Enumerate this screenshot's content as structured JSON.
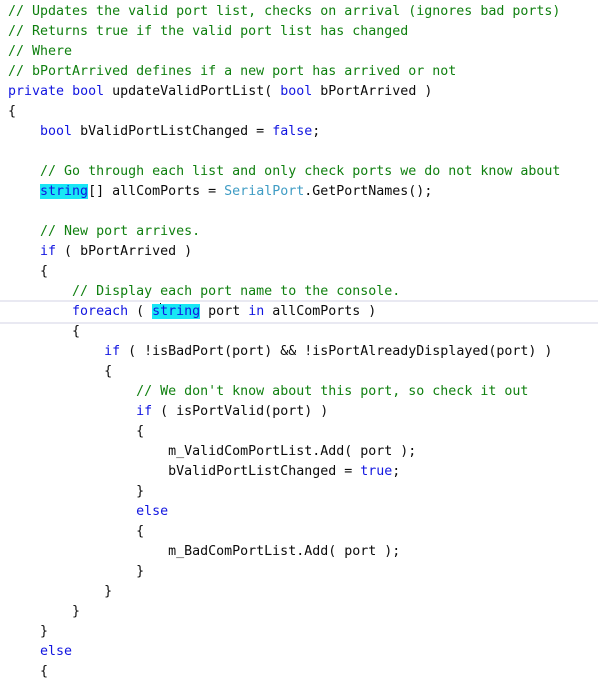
{
  "editor": {
    "name": "code-editor",
    "language": "C#",
    "background_color": "#ffffff",
    "font_size_px": 13.3,
    "line_height_px": 20,
    "tab_size": 4,
    "colors": {
      "comment": "#108010",
      "keyword": "#1216e0",
      "type": "#3f9cc4",
      "plain_text": "#0b0b0b",
      "selection_highlight": "#18e7f5",
      "current_line_rule": "#e9e9f2",
      "caret": "#000000"
    },
    "selection": {
      "selected_text": "string",
      "occurrences": 2,
      "caret_line_index": 15,
      "caret_after_characters": "s"
    }
  },
  "code": {
    "lines": [
      {
        "n": 1,
        "current": false,
        "tokens": [
          {
            "t": "cmt",
            "s": "// Updates the valid port list, checks on arrival (ignores bad ports)"
          }
        ]
      },
      {
        "n": 2,
        "current": false,
        "tokens": [
          {
            "t": "cmt",
            "s": "// Returns true if the valid port list has changed"
          }
        ]
      },
      {
        "n": 3,
        "current": false,
        "tokens": [
          {
            "t": "cmt",
            "s": "// Where"
          }
        ]
      },
      {
        "n": 4,
        "current": false,
        "tokens": [
          {
            "t": "cmt",
            "s": "// bPortArrived defines if a new port has arrived or not"
          }
        ]
      },
      {
        "n": 5,
        "current": false,
        "tokens": [
          {
            "t": "kw",
            "s": "private"
          },
          {
            "t": "plain",
            "s": " "
          },
          {
            "t": "kw",
            "s": "bool"
          },
          {
            "t": "plain",
            "s": " updateValidPortList( "
          },
          {
            "t": "kw",
            "s": "bool"
          },
          {
            "t": "plain",
            "s": " bPortArrived )"
          }
        ]
      },
      {
        "n": 6,
        "current": false,
        "tokens": [
          {
            "t": "plain",
            "s": "{"
          }
        ]
      },
      {
        "n": 7,
        "current": false,
        "tokens": [
          {
            "t": "plain",
            "s": "    "
          },
          {
            "t": "kw",
            "s": "bool"
          },
          {
            "t": "plain",
            "s": " bValidPortListChanged = "
          },
          {
            "t": "kw",
            "s": "false"
          },
          {
            "t": "plain",
            "s": ";"
          }
        ]
      },
      {
        "n": 8,
        "current": false,
        "tokens": [
          {
            "t": "plain",
            "s": ""
          }
        ]
      },
      {
        "n": 9,
        "current": false,
        "tokens": [
          {
            "t": "plain",
            "s": "    "
          },
          {
            "t": "cmt",
            "s": "// Go through each list and only check ports we do not know about"
          }
        ]
      },
      {
        "n": 10,
        "current": false,
        "tokens": [
          {
            "t": "plain",
            "s": "    "
          },
          {
            "t": "sel",
            "s": "string"
          },
          {
            "t": "plain",
            "s": "[] allComPorts = "
          },
          {
            "t": "typ",
            "s": "SerialPort"
          },
          {
            "t": "plain",
            "s": ".GetPortNames();"
          }
        ]
      },
      {
        "n": 11,
        "current": false,
        "tokens": [
          {
            "t": "plain",
            "s": ""
          }
        ]
      },
      {
        "n": 12,
        "current": false,
        "tokens": [
          {
            "t": "plain",
            "s": "    "
          },
          {
            "t": "cmt",
            "s": "// New port arrives."
          }
        ]
      },
      {
        "n": 13,
        "current": false,
        "tokens": [
          {
            "t": "plain",
            "s": "    "
          },
          {
            "t": "kw",
            "s": "if"
          },
          {
            "t": "plain",
            "s": " ( bPortArrived )"
          }
        ]
      },
      {
        "n": 14,
        "current": false,
        "tokens": [
          {
            "t": "plain",
            "s": "    {"
          }
        ]
      },
      {
        "n": 15,
        "current": false,
        "tokens": [
          {
            "t": "plain",
            "s": "        "
          },
          {
            "t": "cmt",
            "s": "// Display each port name to the console."
          }
        ]
      },
      {
        "n": 16,
        "current": true,
        "tokens": [
          {
            "t": "plain",
            "s": "        "
          },
          {
            "t": "kw",
            "s": "foreach"
          },
          {
            "t": "plain",
            "s": " ( "
          },
          {
            "t": "sel-caret",
            "s": "string"
          },
          {
            "t": "plain",
            "s": " port "
          },
          {
            "t": "kw",
            "s": "in"
          },
          {
            "t": "plain",
            "s": " allComPorts )"
          }
        ]
      },
      {
        "n": 17,
        "current": false,
        "tokens": [
          {
            "t": "plain",
            "s": "        {"
          }
        ]
      },
      {
        "n": 18,
        "current": false,
        "tokens": [
          {
            "t": "plain",
            "s": "            "
          },
          {
            "t": "kw",
            "s": "if"
          },
          {
            "t": "plain",
            "s": " ( !isBadPort(port) && !isPortAlreadyDisplayed(port) )"
          }
        ]
      },
      {
        "n": 19,
        "current": false,
        "tokens": [
          {
            "t": "plain",
            "s": "            {"
          }
        ]
      },
      {
        "n": 20,
        "current": false,
        "tokens": [
          {
            "t": "plain",
            "s": "                "
          },
          {
            "t": "cmt",
            "s": "// We don't know about this port, so check it out"
          }
        ]
      },
      {
        "n": 21,
        "current": false,
        "tokens": [
          {
            "t": "plain",
            "s": "                "
          },
          {
            "t": "kw",
            "s": "if"
          },
          {
            "t": "plain",
            "s": " ( isPortValid(port) )"
          }
        ]
      },
      {
        "n": 22,
        "current": false,
        "tokens": [
          {
            "t": "plain",
            "s": "                {"
          }
        ]
      },
      {
        "n": 23,
        "current": false,
        "tokens": [
          {
            "t": "plain",
            "s": "                    m_ValidComPortList.Add( port );"
          }
        ]
      },
      {
        "n": 24,
        "current": false,
        "tokens": [
          {
            "t": "plain",
            "s": "                    bValidPortListChanged = "
          },
          {
            "t": "kw",
            "s": "true"
          },
          {
            "t": "plain",
            "s": ";"
          }
        ]
      },
      {
        "n": 25,
        "current": false,
        "tokens": [
          {
            "t": "plain",
            "s": "                }"
          }
        ]
      },
      {
        "n": 26,
        "current": false,
        "tokens": [
          {
            "t": "plain",
            "s": "                "
          },
          {
            "t": "kw",
            "s": "else"
          }
        ]
      },
      {
        "n": 27,
        "current": false,
        "tokens": [
          {
            "t": "plain",
            "s": "                {"
          }
        ]
      },
      {
        "n": 28,
        "current": false,
        "tokens": [
          {
            "t": "plain",
            "s": "                    m_BadComPortList.Add( port );"
          }
        ]
      },
      {
        "n": 29,
        "current": false,
        "tokens": [
          {
            "t": "plain",
            "s": "                }"
          }
        ]
      },
      {
        "n": 30,
        "current": false,
        "tokens": [
          {
            "t": "plain",
            "s": "            }"
          }
        ]
      },
      {
        "n": 31,
        "current": false,
        "tokens": [
          {
            "t": "plain",
            "s": "        }"
          }
        ]
      },
      {
        "n": 32,
        "current": false,
        "tokens": [
          {
            "t": "plain",
            "s": "    }"
          }
        ]
      },
      {
        "n": 33,
        "current": false,
        "tokens": [
          {
            "t": "plain",
            "s": "    "
          },
          {
            "t": "kw",
            "s": "else"
          }
        ]
      },
      {
        "n": 34,
        "current": false,
        "tokens": [
          {
            "t": "plain",
            "s": "    {"
          }
        ]
      }
    ]
  }
}
